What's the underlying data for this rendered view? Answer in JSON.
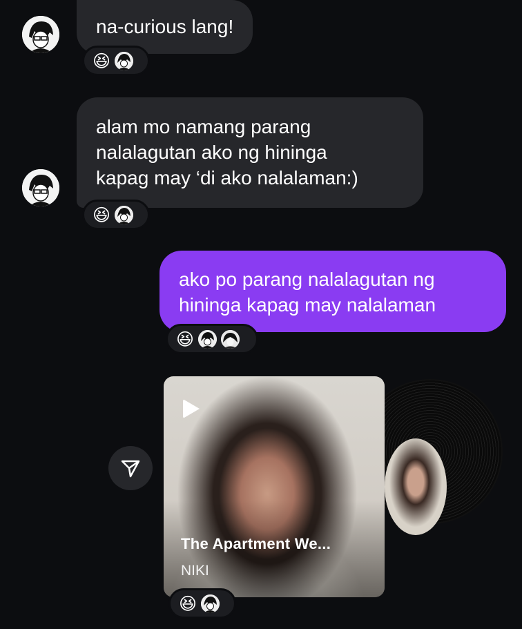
{
  "messages": [
    {
      "direction": "in",
      "text_lines": [
        "na-curious lang!"
      ]
    },
    {
      "direction": "in",
      "text_lines": [
        "alam mo namang parang",
        "nalalagutan ako ng hininga",
        "kapag may ‘di ako nalalaman:)"
      ]
    },
    {
      "direction": "out",
      "text_lines": [
        "ako po parang nalalagutan ng",
        "hininga kapag may nalalaman"
      ]
    }
  ],
  "reactions": {
    "emoji": "😆",
    "msg1": [
      "laughing-emoji",
      "avatar-a"
    ],
    "msg2": [
      "laughing-emoji",
      "avatar-a"
    ],
    "msg3": [
      "laughing-emoji",
      "avatar-a",
      "avatar-b"
    ],
    "music": [
      "laughing-emoji",
      "avatar-a"
    ]
  },
  "music_share": {
    "title": "The Apartment We...",
    "artist": "NIKI",
    "icons": [
      "play-icon",
      "share-icon",
      "vinyl-record-icon"
    ]
  },
  "colors": {
    "background": "#0c0d10",
    "incoming_bubble": "#26272b",
    "outgoing_bubble": "#8a3cf2"
  }
}
